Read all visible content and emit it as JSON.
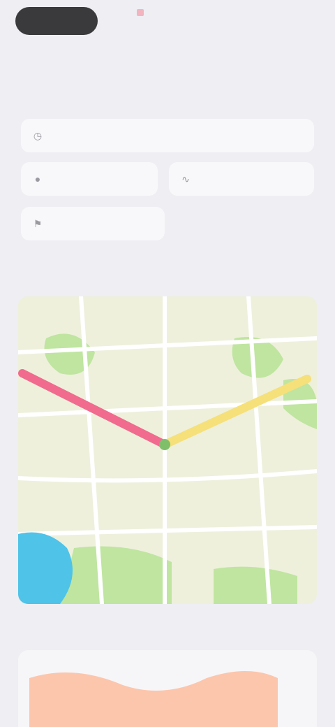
{
  "status": {
    "back_label": "",
    "time": "",
    "right": ""
  },
  "nav": {
    "title": ""
  },
  "sections": {
    "options": {
      "title": ""
    },
    "route": {
      "title": ""
    },
    "elevation": {
      "title": "",
      "trailing": ""
    }
  },
  "options": [
    {
      "label": "",
      "icon": "clock-icon"
    },
    {
      "label": "",
      "icon": "pin-icon"
    },
    {
      "label": "",
      "icon": "route-icon"
    },
    {
      "label": "",
      "icon": "flag-icon"
    }
  ],
  "map": {
    "route_colors": [
      "#f06b8e",
      "#f5e07a"
    ],
    "water_color": "#4fc3e8",
    "park_color": "#bfe5a0",
    "road_color": "#ffffff"
  },
  "elevation_fill_color": "#fcc6ad"
}
